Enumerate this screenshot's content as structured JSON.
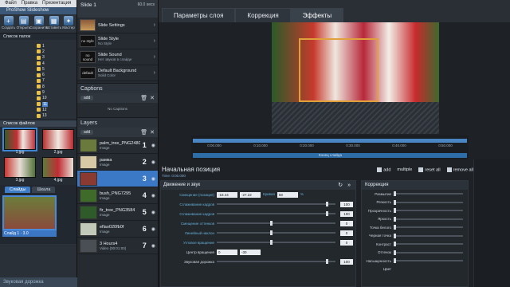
{
  "app": {
    "menu": [
      "Файл",
      "Правка",
      "Презентация"
    ],
    "title": "ProShow Slideshow",
    "toolbar": [
      {
        "label": "Создать",
        "icon": "new-icon"
      },
      {
        "label": "Открыть",
        "icon": "open-icon"
      },
      {
        "label": "Сохранить",
        "icon": "save-icon"
      },
      {
        "label": "Вставить",
        "icon": "insert-icon"
      },
      {
        "label": "Мастер",
        "icon": "wizard-icon"
      }
    ],
    "folders_header": "Список папок",
    "folder_numbers": [
      "1",
      "2",
      "3",
      "4",
      "5",
      "6",
      "7",
      "8",
      "9",
      "10",
      "11",
      "12",
      "13"
    ],
    "files_header": "Список файлов",
    "thumbs": [
      {
        "caption": "1.jpg"
      },
      {
        "caption": "2.jpg"
      },
      {
        "caption": "3.jpg"
      },
      {
        "caption": "4.jpg"
      }
    ],
    "tabs": [
      "Слайды",
      "Шкала"
    ],
    "slide_label": "Слайд 1",
    "slide_time": "3.0",
    "audio_track": "Звуковая дорожка"
  },
  "slide_panel": {
    "title": "Slide 1",
    "duration": "60.0 secs",
    "rows": [
      {
        "icon": "",
        "title": "Slide Settings",
        "sub": ""
      },
      {
        "icon": "no style",
        "title": "Slide Style",
        "sub": "No Style"
      },
      {
        "icon": "no sound",
        "title": "Slide Sound",
        "sub": "Нет звуков в слайде"
      },
      {
        "icon": "default",
        "title": "Default Background",
        "sub": "Solid Color"
      }
    ],
    "captions_header": "Captions",
    "add_label": "add",
    "no_captions": "No Captions",
    "layers_header": "Layers",
    "layers": [
      {
        "name": "palm_tree_PNG2480",
        "type": "Image",
        "num": "1",
        "color": "#6a7a3c"
      },
      {
        "name": "рамка",
        "type": "Image",
        "num": "2",
        "color": "#d8c9a6"
      },
      {
        "name": "",
        "type": "",
        "num": "3",
        "color": "#8a3a30",
        "selected": true
      },
      {
        "name": "bush_PNG7295",
        "type": "Image",
        "num": "4",
        "color": "#3e6a2a"
      },
      {
        "name": "fir_tree_PNG3584",
        "type": "Image",
        "num": "5",
        "color": "#2f5a2a"
      },
      {
        "name": "eflao020fb0f",
        "type": "Image",
        "num": "6",
        "color": "#c3c9b8"
      },
      {
        "name": "3 Hours4",
        "type": "Video (00:01:00)",
        "num": "7",
        "color": "#4a4f55"
      }
    ]
  },
  "editor": {
    "tabs": [
      "Параметры слоя",
      "Коррекция",
      "Эффекты"
    ],
    "active_tab": 2,
    "timeline": {
      "times": [
        "0:00.000",
        "0:10.000",
        "0:20.000",
        "0:30.000",
        "0:40.000",
        "0:50.000"
      ],
      "end_label": "Конец слайда"
    },
    "position_header": "Начальная позиция",
    "position_duration": "Time: 0:00.000",
    "actions": [
      "add",
      "multiple",
      "reset all",
      "remove all"
    ],
    "motion": {
      "header": "Движение и звук",
      "rows": [
        {
          "label": "Смещение (позиция)",
          "kind": "fields",
          "a": "-18.44",
          "b": "-27.22",
          "extra_label": "Кривая",
          "extra": "58",
          "unit": "%"
        },
        {
          "label": "Сглаживание кадров",
          "kind": "slider",
          "value": "100",
          "pos": 0.92
        },
        {
          "label": "Сглаживание кадров",
          "kind": "slider",
          "value": "100",
          "pos": 0.92
        },
        {
          "label": "Смещение оттенков",
          "kind": "slider",
          "value": "0",
          "pos": 0.45
        },
        {
          "label": "Линейный наклон",
          "kind": "slider",
          "value": "0",
          "pos": 0.45
        },
        {
          "label": "Угловое вращение",
          "kind": "slider",
          "value": "0",
          "pos": 0.45
        },
        {
          "label": "Центр вращения",
          "kind": "fields",
          "a": "0",
          "b": "-30",
          "extra_label": "",
          "extra": "",
          "unit": "",
          "white": true
        },
        {
          "label": "Звуковая дорожка",
          "kind": "slider",
          "value": "100",
          "pos": 0.92,
          "white": true
        }
      ]
    },
    "correction": {
      "header": "Коррекция",
      "rows": [
        "Размытие",
        "Резкость",
        "Прозрачность",
        "Яркость",
        "Точка белого",
        "Черная точка",
        "Контраст",
        "Оттенок",
        "Насыщенность"
      ],
      "footer": "Цвет"
    }
  }
}
